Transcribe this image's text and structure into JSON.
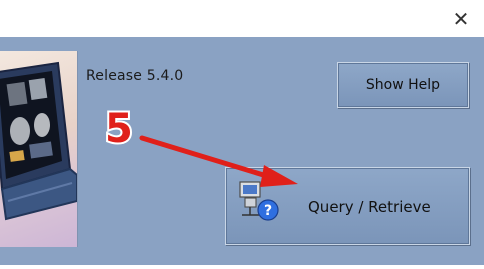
{
  "window": {
    "close_glyph": "✕"
  },
  "panel": {
    "background_color": "#8aa2c3"
  },
  "release_text": "Release 5.4.0",
  "buttons": {
    "show_help": "Show Help",
    "query_retrieve": "Query / Retrieve",
    "query_retrieve_icon": "network-computer-question-icon"
  },
  "annotation": {
    "step_number": "5",
    "color": "#e0201a",
    "arrow_target": "query-retrieve-button"
  }
}
